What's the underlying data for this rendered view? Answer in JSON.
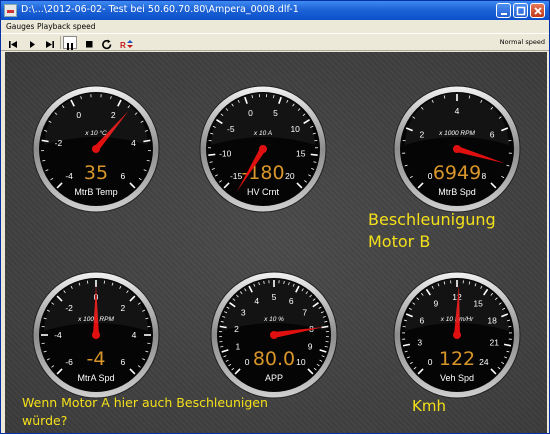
{
  "window": {
    "title": "D:\\...\\2012-06-02- Test bei 50.60.70.80\\Ampera_0008.dlf-1"
  },
  "menu": {
    "items": [
      "Gauges",
      "Playback speed"
    ]
  },
  "toolbar": {
    "buttons": [
      "skip-back",
      "play",
      "skip-forward",
      "pause",
      "stop",
      "repeat",
      "record"
    ],
    "speed_label": "Normal speed"
  },
  "colors": {
    "value": "#d8962a",
    "needle": "#e01010",
    "annotation": "#f4e01a"
  },
  "gauges": [
    {
      "id": "mtrb-temp",
      "label": "MtrB Temp",
      "unit": "x 10 °C",
      "value": "35",
      "ticks": [
        "-4",
        "-2",
        "0",
        "2",
        "4",
        "6"
      ],
      "needle": 2.5,
      "min": -4,
      "max": 6
    },
    {
      "id": "hv-crnt",
      "label": "HV Crnt",
      "unit": "x 10 A",
      "value": "-180",
      "ticks": [
        "-15",
        "-10",
        "-5",
        "0",
        "5",
        "10",
        "15",
        "20"
      ],
      "needle": -18,
      "min": -15,
      "max": 20
    },
    {
      "id": "mtrb-spd",
      "label": "MtrB Spd",
      "unit": "x 1000 RPM",
      "value": "6949",
      "ticks": [
        "0",
        "2",
        "4",
        "6",
        "8"
      ],
      "needle": 6.95,
      "min": -2,
      "max": 8
    },
    {
      "id": "mtra-spd",
      "label": "MtrA Spd",
      "unit": "x 1000 RPM",
      "value": "-4",
      "ticks": [
        "-6",
        "-4",
        "-2",
        "0",
        "2",
        "4",
        "6"
      ],
      "needle": 0,
      "min": -6,
      "max": 6
    },
    {
      "id": "app",
      "label": "APP",
      "unit": "x 10 %",
      "value": "80.0",
      "ticks": [
        "0",
        "1",
        "2",
        "3",
        "4",
        "5",
        "6",
        "7",
        "8",
        "9",
        "10"
      ],
      "needle": 8,
      "min": 0,
      "max": 10
    },
    {
      "id": "veh-spd",
      "label": "Veh Spd",
      "unit": "x 10 Km/Hr",
      "value": "122",
      "ticks": [
        "0",
        "3",
        "6",
        "9",
        "12",
        "15",
        "18",
        "21",
        "24"
      ],
      "needle": 12.2,
      "min": 0,
      "max": 24
    }
  ],
  "annotations": {
    "a1": "Beschleunigung\nMotor B",
    "a2": "Wenn Motor A hier auch Beschleunigen\nwürde?",
    "a3": "Kmh"
  }
}
